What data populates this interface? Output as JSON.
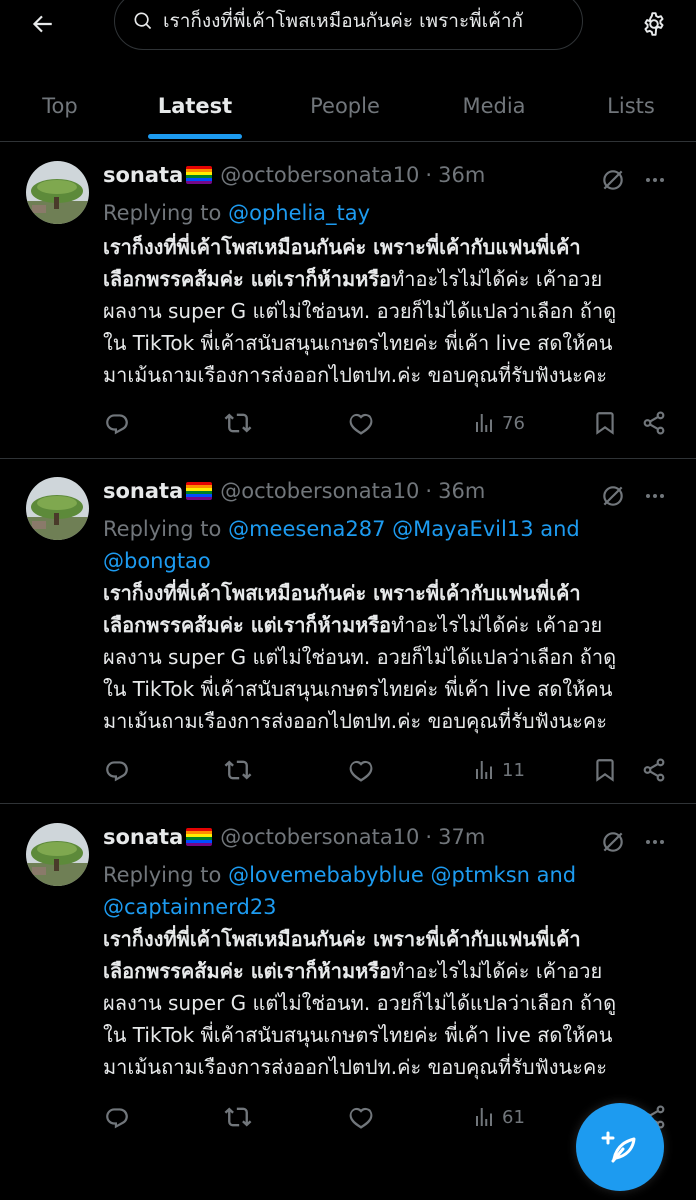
{
  "search": {
    "query": "เราก็งงที่พี่เค้าโพสเหมือนกันค่ะ เพราะพี่เค้ากั"
  },
  "tabs": [
    {
      "label": "Top"
    },
    {
      "label": "Latest"
    },
    {
      "label": "People"
    },
    {
      "label": "Media"
    },
    {
      "label": "Lists"
    }
  ],
  "tweets": [
    {
      "name": "sonata",
      "handle": "@octobersonata10",
      "separator": "·",
      "time": "36m",
      "replying_to_label": "Replying to",
      "mentions_line1": "@ophelia_tay",
      "mentions_line2": "",
      "body_bold_1": "เราก็งงที่พี่เค้าโพสเหมือนกันค่ะ เพราะพี่เค้ากับแฟนพี่เค้า",
      "body_bold_2": "เลือกพรรคส้มค่ะ แต่เราก็ห้ามหรือ",
      "body_rest_2": "ทำอะไรไม่ได้ค่ะ เค้าอวย",
      "body_3": "ผลงาน super G แต่ไม่ใช่อนท. อวยก็ไม่ได้แปลว่าเลือก ถ้าดู",
      "body_4": "ใน TikTok พี่เค้าสนับสนุนเกษตรไทยค่ะ พี่เค้า live สดให้คน",
      "body_5": "มาเม้นถามเรืองการส่งออกไปตปท.ค่ะ ขอบคุณที่รับฟังนะคะ",
      "views": "76"
    },
    {
      "name": "sonata",
      "handle": "@octobersonata10",
      "separator": "·",
      "time": "36m",
      "replying_to_label": "Replying to",
      "mentions_line1": "@meesena287 @MayaEvil13 and",
      "mentions_line2": "@bongtao",
      "body_bold_1": "เราก็งงที่พี่เค้าโพสเหมือนกันค่ะ เพราะพี่เค้ากับแฟนพี่เค้า",
      "body_bold_2": "เลือกพรรคส้มค่ะ แต่เราก็ห้ามหรือ",
      "body_rest_2": "ทำอะไรไม่ได้ค่ะ เค้าอวย",
      "body_3": "ผลงาน super G แต่ไม่ใช่อนท. อวยก็ไม่ได้แปลว่าเลือก ถ้าดู",
      "body_4": "ใน TikTok พี่เค้าสนับสนุนเกษตรไทยค่ะ พี่เค้า live สดให้คน",
      "body_5": "มาเม้นถามเรืองการส่งออกไปตปท.ค่ะ ขอบคุณที่รับฟังนะคะ",
      "views": "11"
    },
    {
      "name": "sonata",
      "handle": "@octobersonata10",
      "separator": "·",
      "time": "37m",
      "replying_to_label": "Replying to",
      "mentions_line1": "@lovemebabyblue @ptmksn and",
      "mentions_line2": "@captainnerd23",
      "body_bold_1": "เราก็งงที่พี่เค้าโพสเหมือนกันค่ะ เพราะพี่เค้ากับแฟนพี่เค้า",
      "body_bold_2": "เลือกพรรคส้มค่ะ แต่เราก็ห้ามหรือ",
      "body_rest_2": "ทำอะไรไม่ได้ค่ะ เค้าอวย",
      "body_3": "ผลงาน super G แต่ไม่ใช่อนท. อวยก็ไม่ได้แปลว่าเลือก ถ้าดู",
      "body_4": "ใน TikTok พี่เค้าสนับสนุนเกษตรไทยค่ะ พี่เค้า live สดให้คน",
      "body_5": "มาเม้นถามเรืองการส่งออกไปตปท.ค่ะ ขอบคุณที่รับฟังนะคะ",
      "views": "61"
    }
  ],
  "icons": {
    "back": "arrow-left-icon",
    "search": "search-icon",
    "settings": "gear-icon",
    "grok": "grok-icon",
    "more": "more-icon",
    "reply": "reply-icon",
    "retweet": "retweet-icon",
    "like": "heart-icon",
    "views": "views-icon",
    "bookmark": "bookmark-icon",
    "share": "share-icon",
    "compose": "compose-icon"
  },
  "colors": {
    "background": "#000000",
    "text": "#e7e9ea",
    "secondary": "#71767b",
    "accent": "#1d9bf0",
    "divider": "#2f3336"
  }
}
